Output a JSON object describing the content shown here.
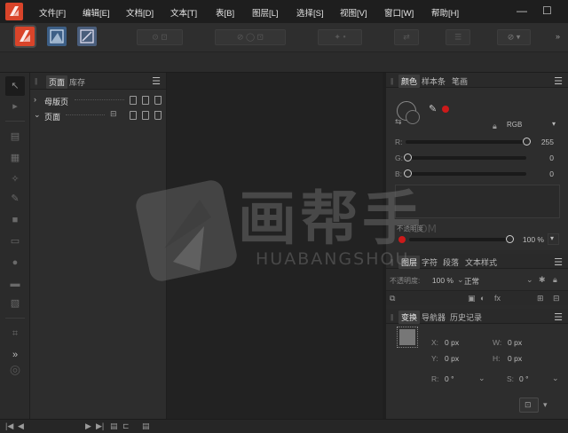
{
  "menubar": {
    "items": [
      "文件[F]",
      "编辑[E]",
      "文档[D]",
      "文本[T]",
      "表[B]",
      "图层[L]",
      "选择[S]",
      "视图[V]",
      "窗口[W]",
      "帮助[H]"
    ],
    "window_controls": [
      "—",
      "☐"
    ]
  },
  "pages_panel": {
    "tabs": [
      "页面",
      "库存"
    ],
    "rows": [
      {
        "label": "母版页",
        "expanded": false
      },
      {
        "label": "页面",
        "expanded": true
      }
    ]
  },
  "color_panel": {
    "tabs": [
      "颜色",
      "样本条",
      "笔画"
    ],
    "model": "RGB",
    "r_label": "R:",
    "r_value": "255",
    "g_label": "G:",
    "g_value": "0",
    "b_label": "B:",
    "b_value": "0",
    "opacity_label": "不透明度",
    "opacity_value": "100 %",
    "accent": "#cc1a1a"
  },
  "layers_panel": {
    "tabs": [
      "图层",
      "字符",
      "段落",
      "文本样式"
    ],
    "opacity_label": "不透明度:",
    "opacity_value": "100 %",
    "blend_mode": "正常"
  },
  "transform_panel": {
    "tabs": [
      "变换",
      "导航器",
      "历史记录"
    ],
    "x_label": "X:",
    "x_value": "0 px",
    "y_label": "Y:",
    "y_value": "0 px",
    "w_label": "W:",
    "w_value": "0 px",
    "h_label": "H:",
    "h_value": "0 px",
    "r_label": "R:",
    "r_value": "0 °",
    "s_label": "S:",
    "s_value": "0 °"
  },
  "watermark": {
    "cn": "画帮手",
    "en": "HUABANGSHOU",
    "suffix": ".COM"
  }
}
